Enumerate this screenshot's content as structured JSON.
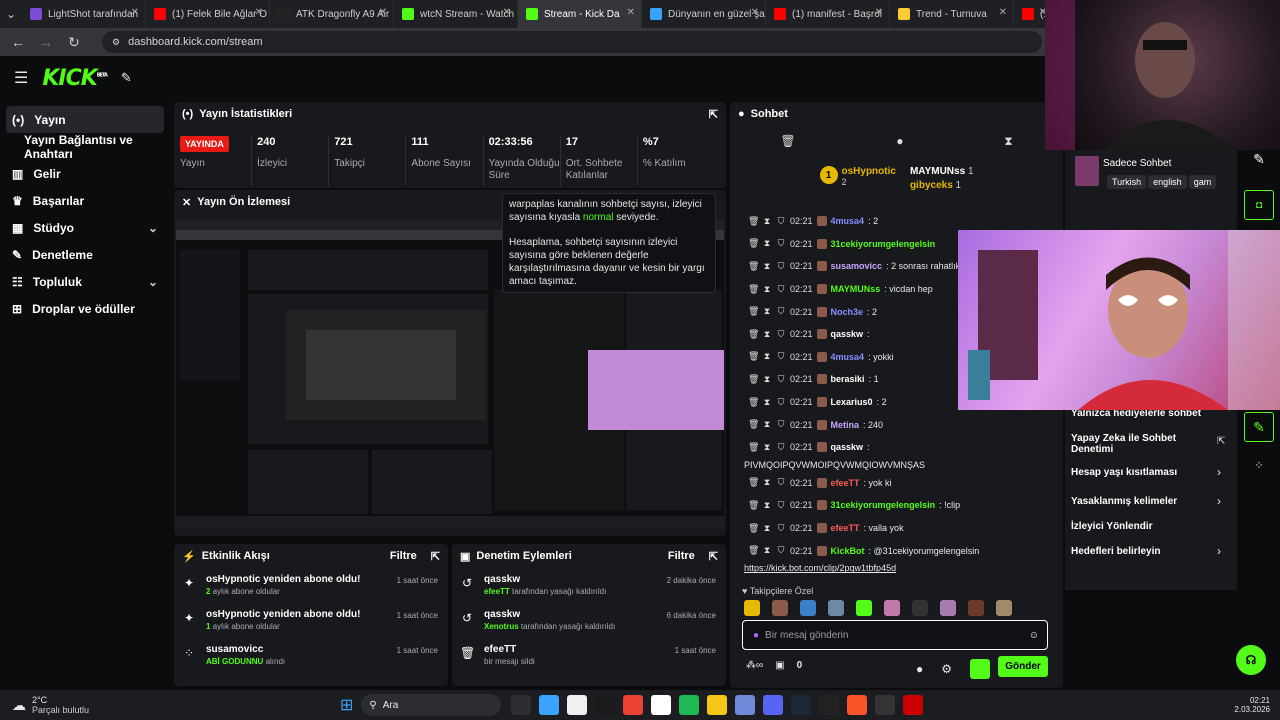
{
  "tabs": [
    {
      "label": "LightShot tarafından",
      "color": "#7b4bd6"
    },
    {
      "label": "(1) Felek Bile Ağlar O",
      "color": "#ff0000"
    },
    {
      "label": "ATK Dragonfly A9 Air",
      "color": "#222222"
    },
    {
      "label": "wtcN Stream - Watch",
      "color": "#53fc18"
    },
    {
      "label": "Stream - Kick Da",
      "color": "#53fc18"
    },
    {
      "label": "Dünyanın en güzel şa",
      "color": "#3aa3ff"
    },
    {
      "label": "(1) manifest - Başrol",
      "color": "#ff0000"
    },
    {
      "label": "Trend - Turnuva",
      "color": "#ffcc33"
    },
    {
      "label": "(1)",
      "color": "#ff0000"
    }
  ],
  "url": "dashboard.kick.com/stream",
  "logo": {
    "text": "KICK",
    "beta": "BETA"
  },
  "sidebar": {
    "items": [
      {
        "label": "Yayın",
        "icon": "broadcast-icon"
      },
      {
        "label": "Yayın Bağlantısı ve Anahtarı",
        "icon": ""
      },
      {
        "label": "Gelir",
        "icon": "chart-icon"
      },
      {
        "label": "Başarılar",
        "icon": "trophy-icon"
      },
      {
        "label": "Stüdyo",
        "icon": "layout-icon"
      },
      {
        "label": "Denetleme",
        "icon": "wrench-icon"
      },
      {
        "label": "Topluluk",
        "icon": "community-icon"
      },
      {
        "label": "Droplar ve ödüller",
        "icon": "gift-icon"
      }
    ]
  },
  "stats": {
    "title": "Yayın İstatistikleri",
    "live": "YAYINDA",
    "live_label": "Yayın",
    "items": [
      {
        "value": "240",
        "label": "İzleyici"
      },
      {
        "value": "721",
        "label": "Takipçi"
      },
      {
        "value": "111",
        "label": "Abone Sayısı"
      },
      {
        "value": "02:33:56",
        "label": "Yayında Olduğu Süre"
      },
      {
        "value": "17",
        "label": "Ort. Sohbete Katılanlar"
      },
      {
        "value": "%7",
        "label": "% Katılım"
      }
    ]
  },
  "preview": {
    "title": "Yayın Ön İzlemesi"
  },
  "tooltip": {
    "p1a": "warpaplas kanalının sohbetçi sayısı, izleyici sayısına kıyasla ",
    "p1b": "normal",
    "p1c": " seviyede.",
    "p2": "Hesaplama, sohbetçi sayısının izleyici sayısına göre beklenen değerle karşılaştırılmasına dayanır ve kesin bir yargı amacı taşımaz."
  },
  "activity": {
    "title": "Etkinlik Akışı",
    "filter": "Filtre",
    "items": [
      {
        "t1": "osHypnotic yeniden abone oldu!",
        "hl": "2",
        "t2": " aylık abone oldular",
        "time": "1 saat önce",
        "icon": "sparkle-icon"
      },
      {
        "t1": "osHypnotic yeniden abone oldu!",
        "hl": "1",
        "t2": " aylık abone oldular",
        "time": "1 saat önce",
        "icon": "sparkle-icon"
      },
      {
        "t1": "susamovicc",
        "hl": "ABİ GODUNNU",
        "t2": " alındı",
        "time": "1 saat önce",
        "icon": "dots-icon"
      }
    ]
  },
  "mod": {
    "title": "Denetim Eylemleri",
    "filter": "Filtre",
    "items": [
      {
        "t1": "qasskw",
        "hl": "efeeTT",
        "t2": " tarafından yasağı kaldırıldı",
        "time": "2 dakika önce",
        "icon": "undo-icon"
      },
      {
        "t1": "qasskw",
        "hl": "Xenotrus",
        "t2": " tarafından yasağı kaldırıldı",
        "time": "6 dakika önce",
        "icon": "undo-icon"
      },
      {
        "t1": "efeeTT",
        "hl": "",
        "t2": "bir mesajı sildi",
        "time": "1 saat önce",
        "icon": "trash-icon"
      }
    ]
  },
  "chat": {
    "title": "Sohbet",
    "pinned": [
      {
        "user": "osHypnotic",
        "count": "2",
        "badge": "1"
      },
      {
        "user": "MAYMUNss",
        "count": "1"
      },
      {
        "user": "gibyceks",
        "count": "1"
      }
    ],
    "messages": [
      {
        "time": "02:21",
        "user": "4musa4",
        "color": "#8a8cff",
        "text": ": 2"
      },
      {
        "time": "02:21",
        "user": "31cekiyorumgelengelsin",
        "color": "#53fc18",
        "text": ""
      },
      {
        "time": "02:21",
        "user": "susamovicc",
        "color": "#c6a7ff",
        "text": ": 2 sonrası rahatlık"
      },
      {
        "time": "02:21",
        "user": "MAYMUNss",
        "color": "#53fc18",
        "text": ": vicdan hep"
      },
      {
        "time": "02:21",
        "user": "Noch3e",
        "color": "#8a8cff",
        "text": ": 2"
      },
      {
        "time": "02:21",
        "user": "qasskw",
        "color": "#ffffff",
        "text": ":"
      },
      {
        "time": "02:21",
        "user": "4musa4",
        "color": "#8a8cff",
        "text": ": yokki"
      },
      {
        "time": "02:21",
        "user": "berasiki",
        "color": "#ffffff",
        "text": ": 1"
      },
      {
        "time": "02:21",
        "user": "Lexarius0",
        "color": "#ffffff",
        "text": ": 2"
      },
      {
        "time": "02:21",
        "user": "Metina",
        "color": "#c6a7ff",
        "text": ": 240"
      },
      {
        "time": "02:21",
        "user": "qasskw",
        "color": "#ffffff",
        "text": ":",
        "cont": "PIVMQOIPQVWMOIPQVWMQIOWVMNŞAS"
      },
      {
        "time": "02:21",
        "user": "efeeTT",
        "color": "#ff5a5a",
        "text": ": yok ki"
      },
      {
        "time": "02:21",
        "user": "31cekiyorumgelengelsin",
        "color": "#53fc18",
        "text": ": !clip"
      },
      {
        "time": "02:21",
        "user": "efeeTT",
        "color": "#ff5a5a",
        "text": ": valla yok"
      },
      {
        "time": "02:21",
        "user": "KickBot",
        "color": "#53fc18",
        "text": ": @31cekiyorumgelengelsin",
        "cont": "https://kick.bot.com/clip/2pqw1tbfp45d"
      }
    ],
    "followers_only": "Takipçilere Özel",
    "placeholder": "Bir mesaj gönderin",
    "count": "0",
    "send": "Gönder"
  },
  "right": {
    "chat_only": "Sadece Sohbet",
    "tags": [
      "Turkish",
      "english",
      "gam"
    ],
    "items": [
      "Yalnızca hediyelerle sohbet",
      "Yapay Zeka ile Sohbet Denetimi",
      "Hesap yaşı kısıtlaması",
      "Yasaklanmış kelimeler",
      "İzleyici Yönlendir",
      "Hedefleri belirleyin"
    ]
  },
  "taskbar": {
    "temp": "2°C",
    "weather": "Parçalı bulutlu",
    "search": "Ara",
    "time": "02:21",
    "date": "2.03.2026"
  }
}
